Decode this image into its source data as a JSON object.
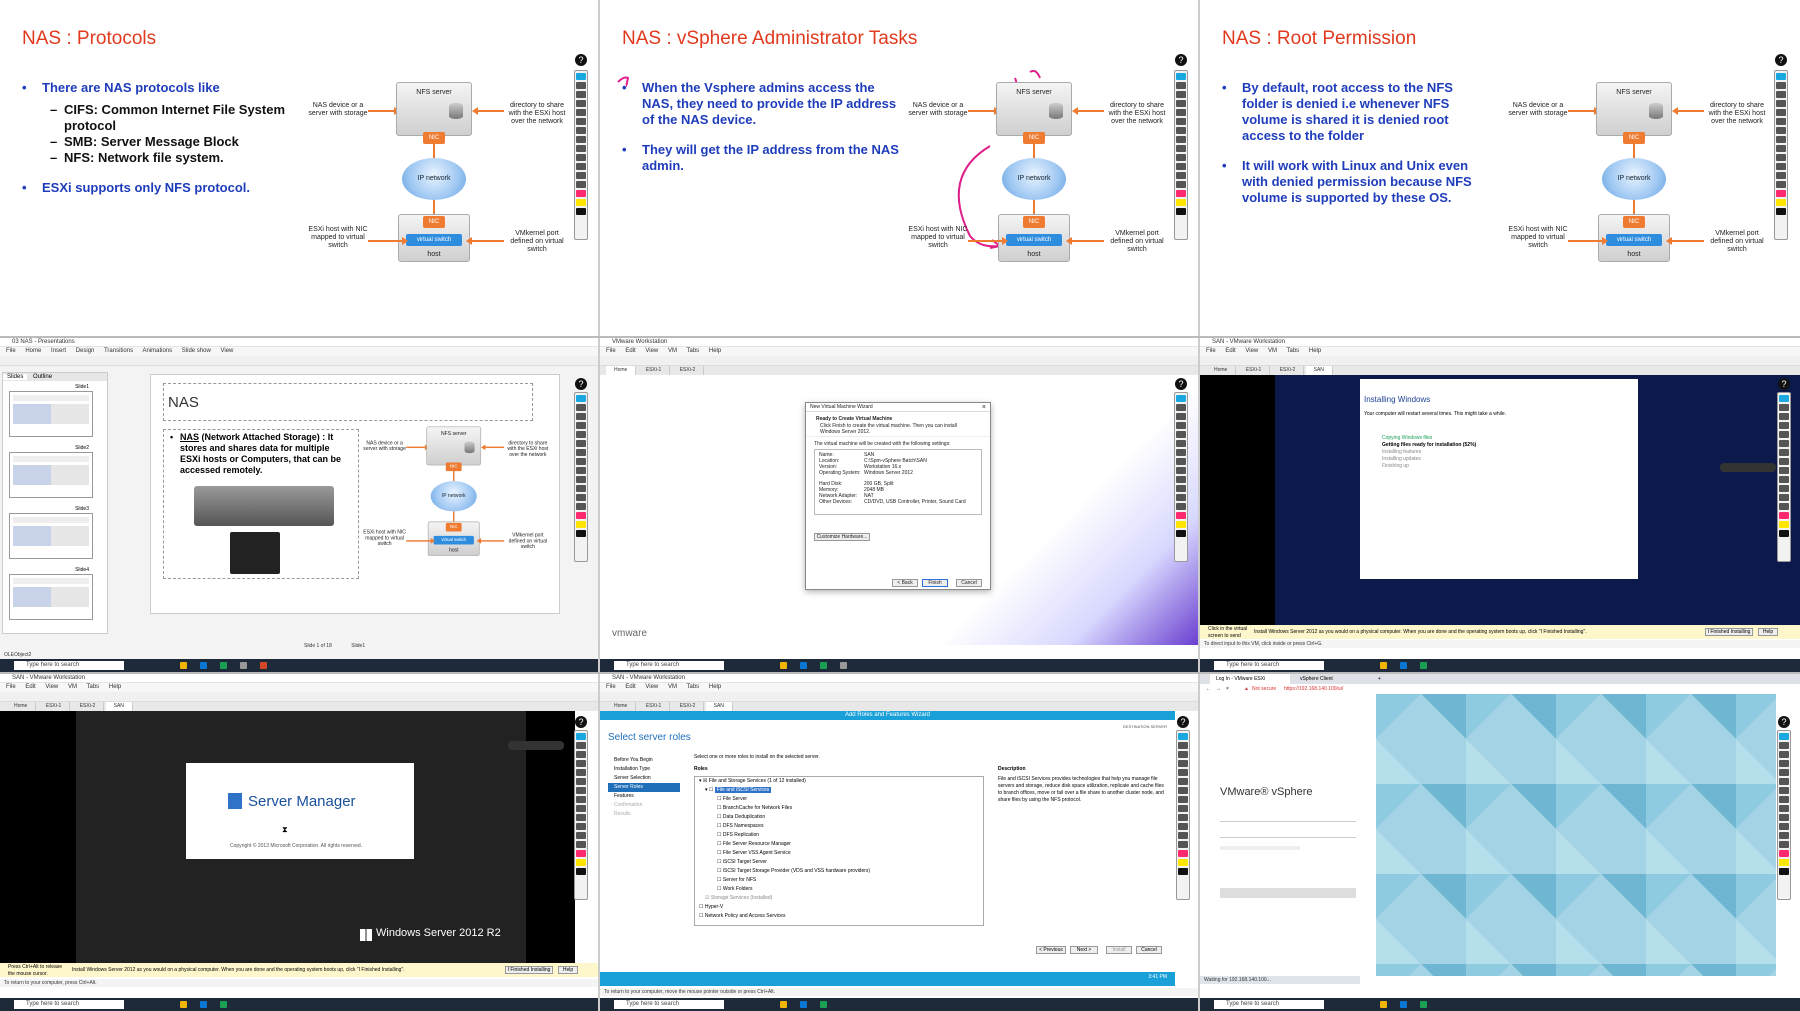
{
  "slides": [
    {
      "title": "NAS : Protocols",
      "bullets": [
        {
          "text": "There are  NAS protocols like",
          "subs": [
            "CIFS: Common Internet File System protocol",
            "SMB: Server Message Block",
            "NFS: Network file system."
          ]
        },
        {
          "text": "ESXi supports only NFS protocol.",
          "subs": []
        }
      ]
    },
    {
      "title": "NAS : vSphere Administrator Tasks",
      "bullets": [
        {
          "text": "When the Vsphere admins access the NAS, they need to provide the IP address of the NAS device.",
          "subs": []
        },
        {
          "text": "They will get the IP address from the NAS admin.",
          "subs": []
        }
      ]
    },
    {
      "title": "NAS : Root Permission",
      "bullets": [
        {
          "text": "By default, root access to the NFS folder is denied i.e whenever NFS volume is shared it is denied root access to the folder",
          "subs": []
        },
        {
          "text": "It will work with Linux and Unix even with denied permission because NFS volume is supported by these OS.",
          "subs": []
        }
      ]
    }
  ],
  "diagram": {
    "nfs_server": "NFS server",
    "nic": "NIC",
    "ip_network": "IP network",
    "virtual_switch": "virtual switch",
    "host": "host",
    "nas_device": "NAS device or a server with storage",
    "directory_share": "directory to share with the ESXi host over the network",
    "esxi_host": "ESXi host with NIC mapped to virtual switch",
    "vmkernel_port": "VMkernel port defined on virtual switch"
  },
  "powerpoint": {
    "title": "03 NAS - Presentations",
    "menu": [
      "File",
      "Home",
      "Insert",
      "Design",
      "Transitions",
      "Animations",
      "Slide show",
      "View"
    ],
    "panel_tabs": [
      "Slides",
      "Outline"
    ],
    "slide_labels": [
      "Slide1",
      "Slide2",
      "Slide3",
      "Slide4"
    ],
    "slide_title": "NAS",
    "bullet_term": "NAS",
    "bullet_text": " (Network Attached Storage) : It stores and shares data for multiple ESXi hosts or Computers, that can be accessed remotely.",
    "status": "Slide 1 of 18",
    "status_theme": "Slide1",
    "bottom": "OLEObject2"
  },
  "vmware_wizard": {
    "window_title": "VMware Workstation",
    "menu": [
      "File",
      "Edit",
      "View",
      "VM",
      "Tabs",
      "Help"
    ],
    "tabs": [
      "Home",
      "ESXi-1",
      "ESXi-2"
    ],
    "dialog_title": "New Virtual Machine Wizard",
    "heading": "Ready to Create Virtual Machine",
    "sub": "Click Finish to create the virtual machine. Then you can install Windows Server 2012.",
    "intro": "The virtual machine will be created with the following settings:",
    "settings": [
      [
        "Name:",
        "SAN"
      ],
      [
        "Location:",
        "C:\\Spm-vSphere Batch\\SAN"
      ],
      [
        "Version:",
        "Workstation 16.x"
      ],
      [
        "Operating System:",
        "Windows Server 2012"
      ],
      [
        "",
        ""
      ],
      [
        "Hard Disk:",
        "200 GB, Split"
      ],
      [
        "Memory:",
        "2048 MB"
      ],
      [
        "Network Adapter:",
        "NAT"
      ],
      [
        "Other Devices:",
        "CD/DVD, USB Controller, Printer, Sound Card"
      ]
    ],
    "customize": "Customize Hardware...",
    "back": "< Back",
    "finish": "Finish",
    "cancel": "Cancel",
    "brand": "vmware"
  },
  "install_windows": {
    "window_title": "SAN - VMware Workstation",
    "menu": [
      "File",
      "Edit",
      "View",
      "VM",
      "Tabs",
      "Help"
    ],
    "tabs": [
      "Home",
      "ESXi-1",
      "ESXi-2",
      "SAN"
    ],
    "heading": "Installing Windows",
    "sub": "Your computer will restart several times. This might take a while.",
    "steps": [
      "Copying Windows files",
      "Getting files ready for installation (52%)",
      "Installing features",
      "Installing updates",
      "Finishing up"
    ],
    "hint": "Install Windows Server 2012 as you would on a physical computer. When you are done and the operating system boots up, click \"I Finished Installing\".",
    "hint_left": "Click in the virtual screen to send keystrokes",
    "finished_btn": "I Finished Installing",
    "help_btn": "Help",
    "status": "To direct input to this VM, click inside or press Ctrl+G."
  },
  "server_manager": {
    "window_title": "SAN - VMware Workstation",
    "menu": [
      "File",
      "Edit",
      "View",
      "VM",
      "Tabs",
      "Help"
    ],
    "tabs": [
      "Home",
      "ESXi-1",
      "ESXi-2",
      "SAN"
    ],
    "title": "Server Manager",
    "copyright": "Copyright © 2013  Microsoft Corporation. All rights reserved.",
    "brand": "Windows Server 2012 R2",
    "hint_left": "Press Ctrl+Alt to release the mouse cursor.",
    "hint": "Install Windows Server 2012 as you would on a physical computer. When you are done and the operating system boots up, click \"I Finished Installing\".",
    "finished_btn": "I Finished Installing",
    "help_btn": "Help",
    "status": "To return to your computer, press Ctrl+Alt."
  },
  "roles_wizard": {
    "window_title": "SAN - VMware Workstation",
    "menu": [
      "File",
      "Edit",
      "View",
      "VM",
      "Tabs",
      "Help"
    ],
    "tabs": [
      "Home",
      "ESXi-1",
      "ESXi-2",
      "SAN"
    ],
    "bar_title": "Add Roles and Features Wizard",
    "heading": "Select server roles",
    "dest": "DESTINATION SERVER",
    "nav": [
      "Before You Begin",
      "Installation Type",
      "Server Selection",
      "Server Roles",
      "Features",
      "Confirmation",
      "Results"
    ],
    "instruction": "Select one or more roles to install on the selected server.",
    "roles_label": "Roles",
    "roles": [
      "File and Storage Services (1 of 12 installed)",
      "File and iSCSI Services",
      "File Server",
      "BranchCache for Network Files",
      "Data Deduplication",
      "DFS Namespaces",
      "DFS Replication",
      "File Server Resource Manager",
      "File Server VSS Agent Service",
      "iSCSI Target Server",
      "iSCSI Target Storage Provider (VDS and VSS hardware providers)",
      "Server for NFS",
      "Work Folders",
      "Storage Services (Installed)",
      "Hyper-V",
      "Network Policy and Access Services"
    ],
    "desc_label": "Description",
    "desc": "File and iSCSI Services provides technologies that help you manage file servers and storage, reduce disk space utilization, replicate and cache files to branch offices, move or fail over a file share to another cluster node, and share files by using the NFS protocol.",
    "prev": "< Previous",
    "next": "Next >",
    "install": "Install",
    "cancel": "Cancel",
    "clock": "3:41 PM",
    "status": "To return to your computer, move the mouse pointer outside or press Ctrl+Alt."
  },
  "browser": {
    "tabs": [
      "Log In - VMware ESXi",
      "vSphere Client"
    ],
    "not_secure": "Not secure",
    "url": "https://192.168.140.100/ui/",
    "product": "VMware® vSphere",
    "status": "Waiting for 192.168.140.100..."
  },
  "taskbar": {
    "search": "Type here to search"
  },
  "colors": {
    "slide_title": "#e03a1e",
    "slide_text": "#1f3dbb",
    "accent_orange": "#ee7b30",
    "switch_blue": "#2f8de0",
    "annotation_pink": "#e0208a"
  }
}
